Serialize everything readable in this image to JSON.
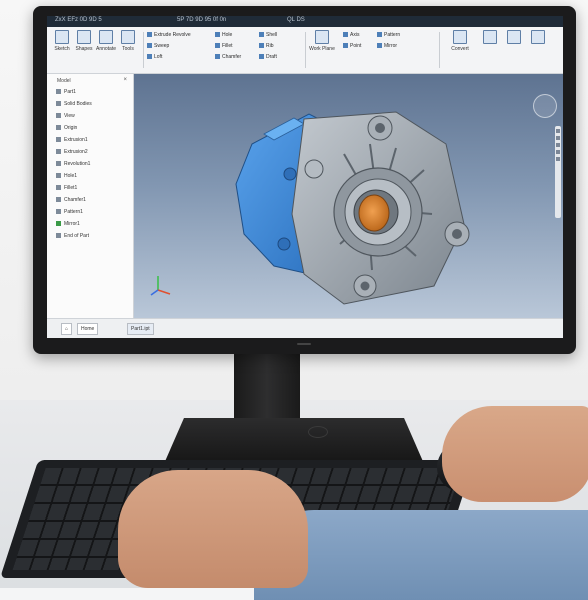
{
  "app": {
    "title_segments": [
      "ZxX EFz 0D 9D 5",
      "5P 7D 9D 95 0f 0n",
      "QL DS"
    ],
    "accent": "#1f2b38"
  },
  "ribbon": {
    "tabs": [
      "Sketch",
      "Shapes",
      "Annotate",
      "Tools"
    ],
    "small_buttons": [
      {
        "label": "Extrude Revolve",
        "icon": "extrude-icon"
      },
      {
        "label": "Sweep",
        "icon": "sweep-icon"
      },
      {
        "label": "Loft",
        "icon": "loft-icon"
      },
      {
        "label": "Hole",
        "icon": "hole-icon"
      },
      {
        "label": "Fillet",
        "icon": "fillet-icon"
      },
      {
        "label": "Chamfer",
        "icon": "chamfer-icon"
      },
      {
        "label": "Shell",
        "icon": "shell-icon"
      },
      {
        "label": "Rib",
        "icon": "rib-icon"
      },
      {
        "label": "Draft",
        "icon": "draft-icon"
      }
    ],
    "right_labels": [
      "Work Plane",
      "Axis",
      "Point",
      "Pattern",
      "Mirror",
      "Convert"
    ]
  },
  "browser": {
    "header": "Model",
    "tree": [
      "Part1",
      "Solid Bodies",
      "View",
      "Origin",
      "Extrusion1",
      "Extrusion2",
      "Revolution1",
      "Hole1",
      "Fillet1",
      "Chamfer1",
      "Pattern1",
      "Mirror1",
      "End of Part"
    ]
  },
  "viewport": {
    "model_colors": {
      "blue": "#3d86d4",
      "gray": "#9aa3ab",
      "orange": "#d9822b"
    },
    "navbar_icons": [
      "pan-icon",
      "zoom-icon",
      "orbit-icon",
      "look-at-icon",
      "view-icon"
    ]
  },
  "status": {
    "tabs": [
      "Home",
      "Part1.ipt"
    ]
  }
}
